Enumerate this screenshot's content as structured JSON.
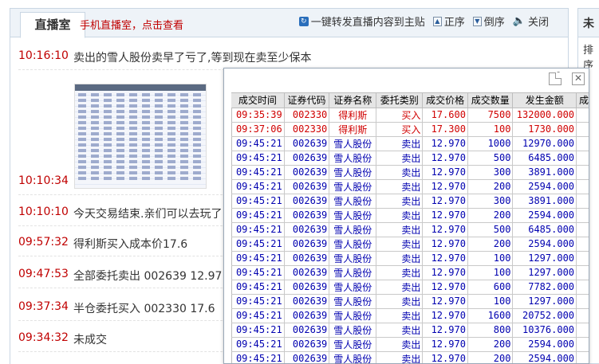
{
  "header": {
    "tab_label": "直播室",
    "mobile_link": "手机直播室，点击查看",
    "actions": {
      "forward": "一键转发直播内容到主贴",
      "asc": "正序",
      "desc": "倒序",
      "close": "关闭"
    }
  },
  "feed": [
    {
      "time": "10:16:10",
      "content": "卖出的雪人股份卖早了亏了,等到现在卖至少保本"
    },
    {
      "time": "10:10:34",
      "content": ""
    },
    {
      "time": "10:10:10",
      "content": "今天交易结束.亲们可以去玩了"
    },
    {
      "time": "09:57:32",
      "content": "得利斯买入成本价17.6"
    },
    {
      "time": "09:47:53",
      "content": "全部委托卖出 002639  12.97"
    },
    {
      "time": "09:37:34",
      "content": "半仓委托买入 002330  17.6"
    },
    {
      "time": "09:34:32",
      "content": "未成交"
    }
  ],
  "side": {
    "tab": "未",
    "sort": "排序"
  },
  "popup": {
    "columns": [
      "成交时间",
      "证券代码",
      "证券名称",
      "委托类别",
      "成交价格",
      "成交数量",
      "发生金额",
      "成"
    ],
    "rows": [
      {
        "time": "09:35:39",
        "code": "002330",
        "name": "得利斯",
        "type": "买入",
        "price": "17.600",
        "qty": "7500",
        "amount": "132000.000",
        "kind": "buy"
      },
      {
        "time": "09:37:06",
        "code": "002330",
        "name": "得利斯",
        "type": "买入",
        "price": "17.300",
        "qty": "100",
        "amount": "1730.000",
        "kind": "buy"
      },
      {
        "time": "09:45:21",
        "code": "002639",
        "name": "雪人股份",
        "type": "卖出",
        "price": "12.970",
        "qty": "1000",
        "amount": "12970.000",
        "kind": "sell"
      },
      {
        "time": "09:45:21",
        "code": "002639",
        "name": "雪人股份",
        "type": "卖出",
        "price": "12.970",
        "qty": "500",
        "amount": "6485.000",
        "kind": "sell"
      },
      {
        "time": "09:45:21",
        "code": "002639",
        "name": "雪人股份",
        "type": "卖出",
        "price": "12.970",
        "qty": "300",
        "amount": "3891.000",
        "kind": "sell"
      },
      {
        "time": "09:45:21",
        "code": "002639",
        "name": "雪人股份",
        "type": "卖出",
        "price": "12.970",
        "qty": "200",
        "amount": "2594.000",
        "kind": "sell"
      },
      {
        "time": "09:45:21",
        "code": "002639",
        "name": "雪人股份",
        "type": "卖出",
        "price": "12.970",
        "qty": "300",
        "amount": "3891.000",
        "kind": "sell"
      },
      {
        "time": "09:45:21",
        "code": "002639",
        "name": "雪人股份",
        "type": "卖出",
        "price": "12.970",
        "qty": "200",
        "amount": "2594.000",
        "kind": "sell"
      },
      {
        "time": "09:45:21",
        "code": "002639",
        "name": "雪人股份",
        "type": "卖出",
        "price": "12.970",
        "qty": "500",
        "amount": "6485.000",
        "kind": "sell"
      },
      {
        "time": "09:45:21",
        "code": "002639",
        "name": "雪人股份",
        "type": "卖出",
        "price": "12.970",
        "qty": "200",
        "amount": "2594.000",
        "kind": "sell"
      },
      {
        "time": "09:45:21",
        "code": "002639",
        "name": "雪人股份",
        "type": "卖出",
        "price": "12.970",
        "qty": "100",
        "amount": "1297.000",
        "kind": "sell"
      },
      {
        "time": "09:45:21",
        "code": "002639",
        "name": "雪人股份",
        "type": "卖出",
        "price": "12.970",
        "qty": "100",
        "amount": "1297.000",
        "kind": "sell"
      },
      {
        "time": "09:45:21",
        "code": "002639",
        "name": "雪人股份",
        "type": "卖出",
        "price": "12.970",
        "qty": "600",
        "amount": "7782.000",
        "kind": "sell"
      },
      {
        "time": "09:45:21",
        "code": "002639",
        "name": "雪人股份",
        "type": "卖出",
        "price": "12.970",
        "qty": "100",
        "amount": "1297.000",
        "kind": "sell"
      },
      {
        "time": "09:45:21",
        "code": "002639",
        "name": "雪人股份",
        "type": "卖出",
        "price": "12.970",
        "qty": "1600",
        "amount": "20752.000",
        "kind": "sell"
      },
      {
        "time": "09:45:21",
        "code": "002639",
        "name": "雪人股份",
        "type": "卖出",
        "price": "12.970",
        "qty": "800",
        "amount": "10376.000",
        "kind": "sell"
      },
      {
        "time": "09:45:21",
        "code": "002639",
        "name": "雪人股份",
        "type": "卖出",
        "price": "12.970",
        "qty": "200",
        "amount": "2594.000",
        "kind": "sell"
      },
      {
        "time": "09:45:21",
        "code": "002639",
        "name": "雪人股份",
        "type": "卖出",
        "price": "12.970",
        "qty": "200",
        "amount": "2594.000",
        "kind": "sell"
      }
    ]
  }
}
